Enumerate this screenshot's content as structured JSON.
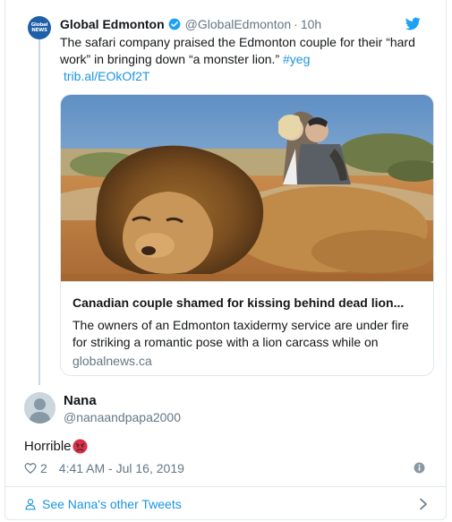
{
  "quoted_tweet": {
    "avatar_logo": "Global NEWS",
    "author_name": "Global Edmonton",
    "author_handle": "@GlobalEdmonton",
    "separator": "·",
    "time": "10h",
    "text_main": "The safari company praised the Edmonton couple for their “hard work” in bringing down “a monster lion.”",
    "hashtag": "#yeg",
    "link": "trib.al/EOkOf2T",
    "link_card": {
      "title": "Canadian couple shamed for kissing behind dead lion...",
      "description": "The owners of an Edmonton taxidermy service are under fire for striking a romantic pose with a lion carcass while on",
      "domain": "globalnews.ca"
    }
  },
  "reply": {
    "name": "Nana",
    "handle": "@nanaandpapa2000",
    "text": "Horrible",
    "emoji": "angry-face",
    "likes": "2",
    "timestamp": "4:41 AM - Jul 16, 2019"
  },
  "footer": {
    "see_more": "See Nana's other Tweets"
  },
  "colors": {
    "link_blue": "#1b95e0",
    "muted": "#657786",
    "border": "#e1e8ed",
    "brand_blue": "#1da1f2",
    "verified_blue": "#1da1f2"
  }
}
